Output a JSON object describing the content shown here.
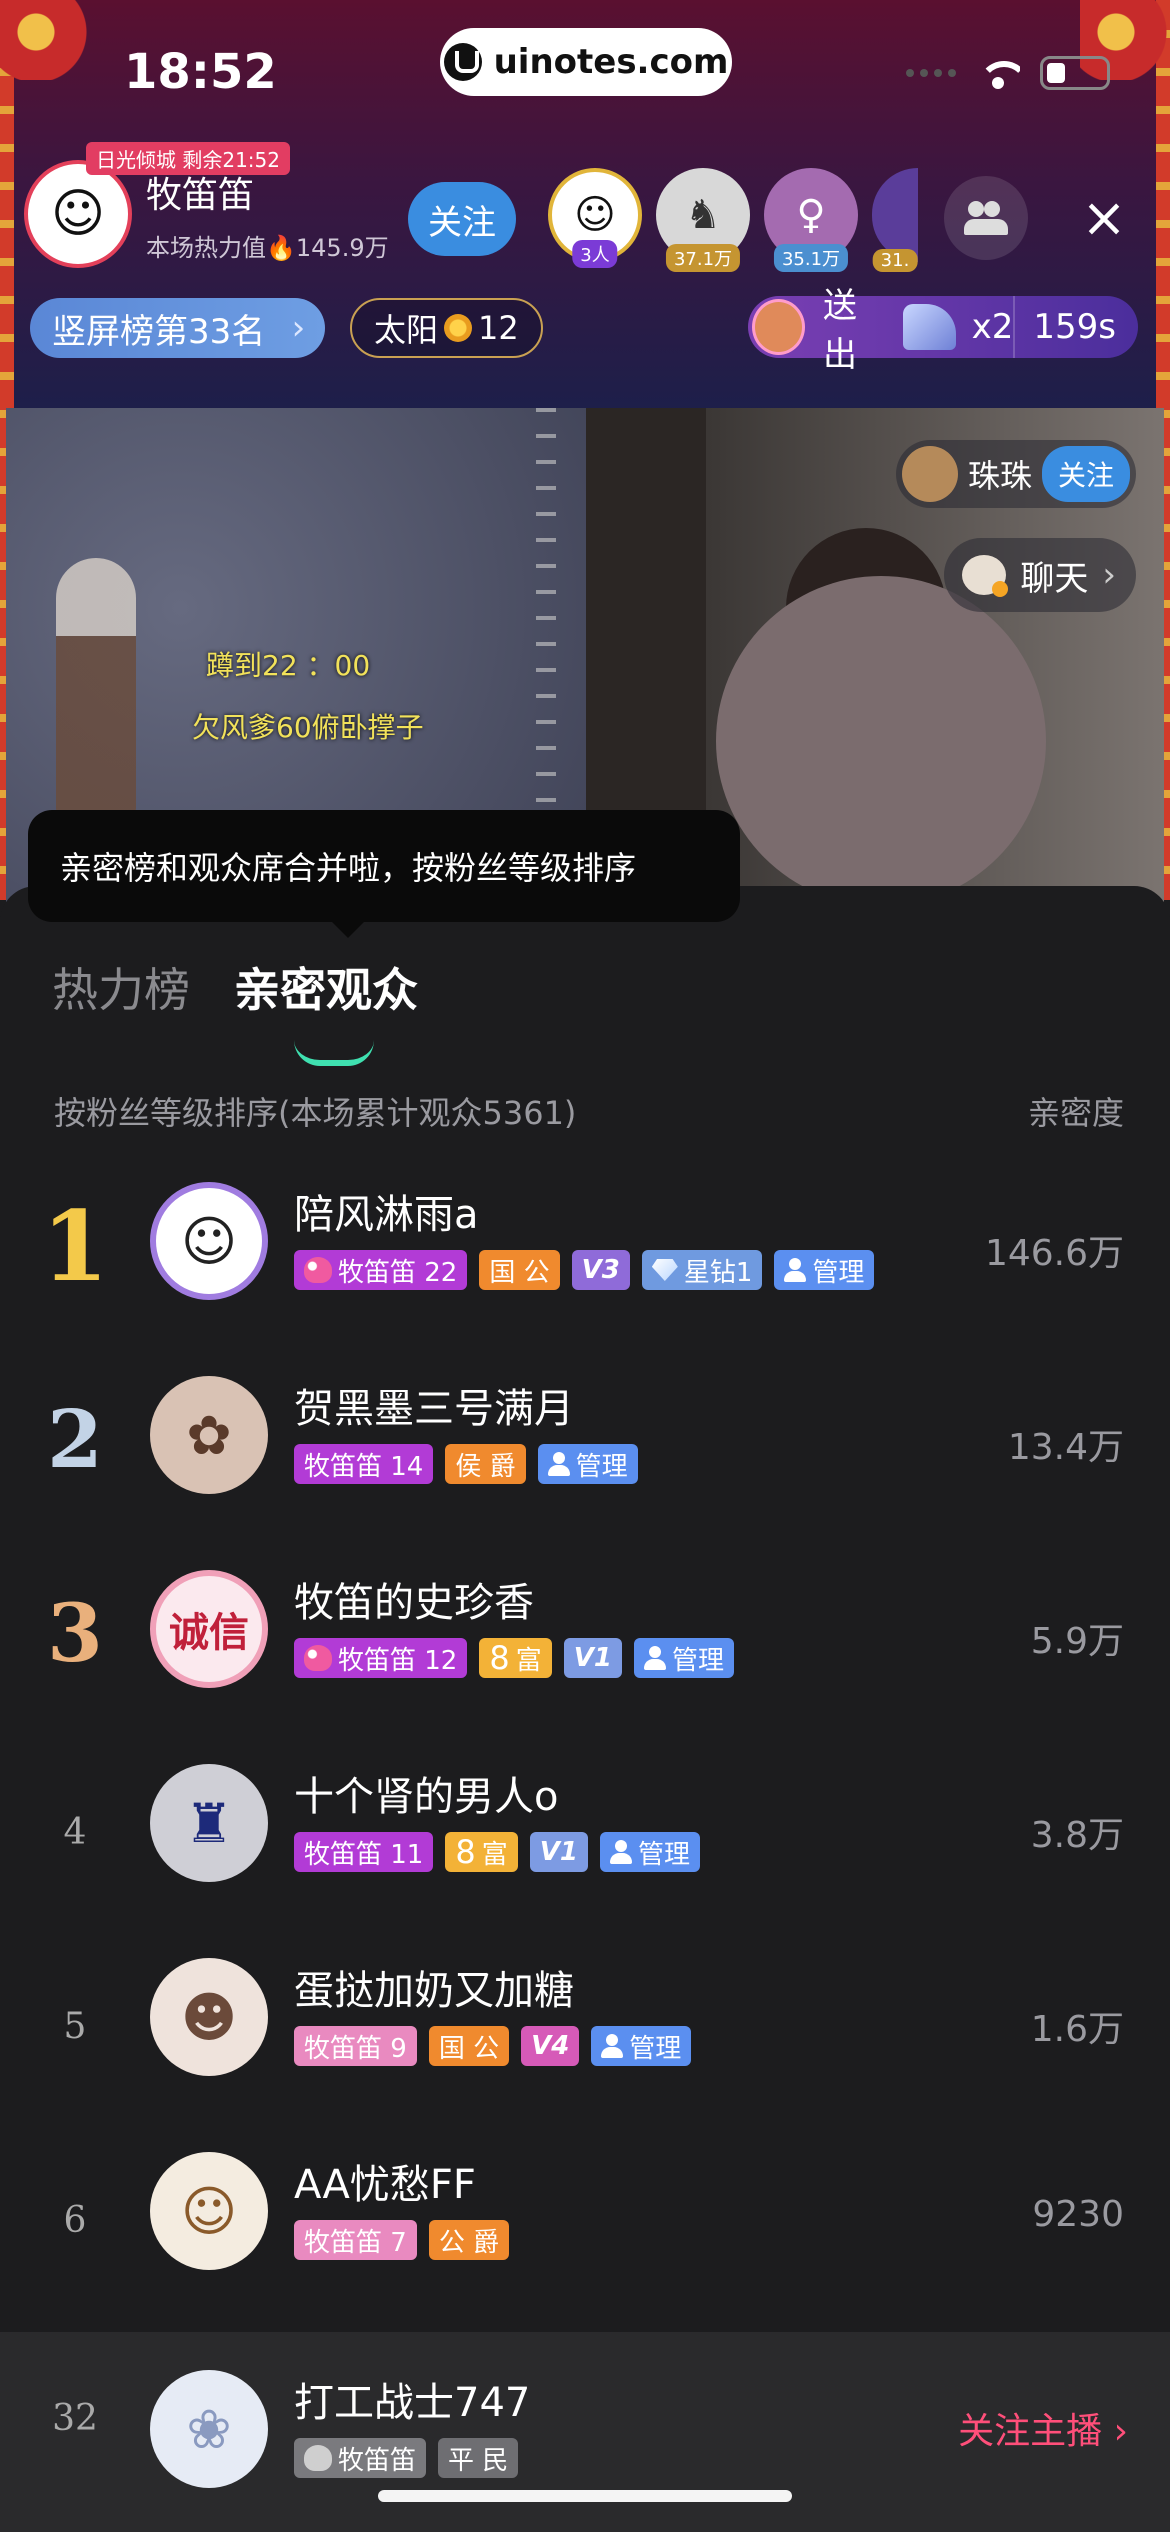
{
  "status_bar": {
    "time": "18:52"
  },
  "watermark": {
    "text": "uinotes.com"
  },
  "host": {
    "tag": "日光倾城 剩余21:52",
    "name": "牧笛笛",
    "heat": "本场热力值🔥145.9万",
    "follow_label": "关注",
    "avatar_glyph": "☺"
  },
  "viewers": [
    {
      "label": "3人",
      "glyph": "☺"
    },
    {
      "label": "37.1万",
      "glyph": "♞"
    },
    {
      "label": "35.1万",
      "glyph": "♀"
    },
    {
      "label": "31.",
      "glyph": ""
    }
  ],
  "icons": {
    "people": "people-icon",
    "close": "close-icon"
  },
  "rank_pill": {
    "text": "竖屏榜第33名",
    "chevron": "›"
  },
  "sun_pill": {
    "text": "太阳",
    "count": "12"
  },
  "gift": {
    "text": "送出",
    "count": "x2",
    "timer": "159s"
  },
  "video": {
    "overlay_line1": "蹲到22 ：00",
    "overlay_line2": "欠风爹60俯卧撑子",
    "anchor_name": "珠珠",
    "anchor_follow": "关注",
    "chat_label": "聊天",
    "chat_chevron": "›"
  },
  "tooltip": {
    "text": "亲密榜和观众席合并啦，按粉丝等级排序"
  },
  "tabs": [
    {
      "label": "热力榜",
      "active": false
    },
    {
      "label": "亲密观众",
      "active": true
    }
  ],
  "list_header": {
    "left": "按粉丝等级排序(本场累计观众5361)",
    "right": "亲密度"
  },
  "rows": [
    {
      "rank": "1",
      "name": "陪风淋雨a",
      "score": "146.6万",
      "avatar": "☺",
      "fan": "牧笛笛 22",
      "noble": "国 公",
      "vip": "V3",
      "star": "星钻1",
      "admin": "管理"
    },
    {
      "rank": "2",
      "name": "贺黑墨三号满月",
      "score": "13.4万",
      "avatar": "✿",
      "fan": "牧笛笛 14",
      "noble": "侯 爵",
      "admin": "管理"
    },
    {
      "rank": "3",
      "name": "牧笛的史珍香",
      "score": "5.9万",
      "avatar": "诚信",
      "fan": "牧笛笛 12",
      "rich": "8",
      "rich_label": "富",
      "vip": "V1",
      "admin": "管理"
    },
    {
      "rank": "4",
      "name": "十个肾的男人o",
      "score": "3.8万",
      "avatar": "♜",
      "fan": "牧笛笛 11",
      "rich": "8",
      "rich_label": "富",
      "vip": "V1",
      "admin": "管理"
    },
    {
      "rank": "5",
      "name": "蛋挞加奶又加糖",
      "score": "1.6万",
      "avatar": "☻",
      "fan": "牧笛笛 9",
      "noble": "国 公",
      "vip": "V4",
      "admin": "管理"
    },
    {
      "rank": "6",
      "name": "AA忧愁FF",
      "score": "9230",
      "avatar": "☺",
      "fan": "牧笛笛 7",
      "noble": "公 爵"
    }
  ],
  "me": {
    "rank": "32",
    "name": "打工战士747",
    "avatar": "❀",
    "fan": "牧笛笛",
    "noble": "平 民",
    "follow_host": "关注主播 ›"
  }
}
